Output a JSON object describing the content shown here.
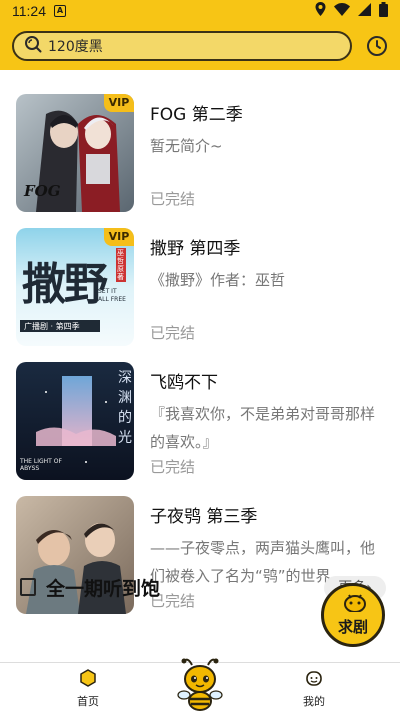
{
  "status_bar": {
    "time": "11:24",
    "indicator": "A"
  },
  "search": {
    "text": "120度黑",
    "icon": "search-icon"
  },
  "list": [
    {
      "title": "FOG 第二季",
      "desc": "暂无简介~",
      "status": "已完结",
      "vip": "VIP"
    },
    {
      "title": "撒野 第四季",
      "desc": "《撒野》作者：巫哲",
      "status": "已完结",
      "vip": "VIP"
    },
    {
      "title": "飞鸥不下",
      "desc": "『我喜欢你，不是弟弟对哥哥那样的喜欢。』",
      "status": "已完结",
      "vip": ""
    },
    {
      "title": "子夜鸮 第三季",
      "desc": "——子夜零点，两声猫头鹰叫，他们被卷入了名为“鸮”的世界。",
      "status": "已完结",
      "vip": ""
    }
  ],
  "cover_text": {
    "fog": "FOG",
    "saye": "撒野",
    "saye_sub": "SET IT ALL FREE",
    "saye_tag": "广播剧 · 第四季",
    "saye_badge": "巫哲原著",
    "feiou_en": "THE LIGHT OF ABYSS",
    "feiou_cn": "深渊的光"
  },
  "section": {
    "title": "全一期听到饱",
    "more": "更多"
  },
  "fab": {
    "label": "求剧"
  },
  "nav": {
    "home": "首页",
    "mine": "我的"
  },
  "colors": {
    "accent": "#f7c515",
    "text_secondary": "#999999"
  }
}
